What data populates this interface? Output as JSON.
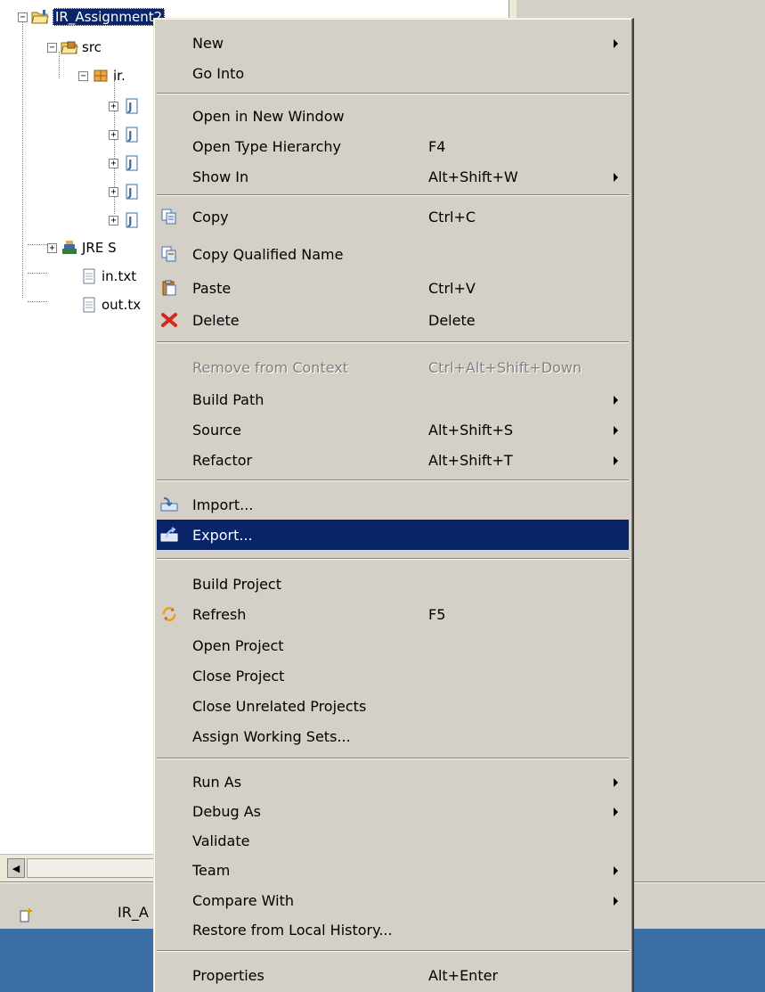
{
  "tree": {
    "project": "IR_Assignment2",
    "src": "src",
    "package": "ir.",
    "jre": "JRE S",
    "files": [
      "in.txt",
      "out.tx"
    ]
  },
  "status_bar": {
    "text": "IR_A"
  },
  "menu": {
    "items": [
      {
        "label": "New",
        "shortcut": "",
        "submenu": true
      },
      {
        "label": "Go Into",
        "shortcut": "",
        "submenu": false
      },
      {
        "label": "Open in New Window",
        "shortcut": "",
        "submenu": false
      },
      {
        "label": "Open Type Hierarchy",
        "shortcut": "F4",
        "submenu": false
      },
      {
        "label": "Show In",
        "shortcut": "Alt+Shift+W",
        "submenu": true
      },
      {
        "label": "Copy",
        "shortcut": "Ctrl+C",
        "submenu": false,
        "icon": "copy-icon"
      },
      {
        "label": "Copy Qualified Name",
        "shortcut": "",
        "submenu": false,
        "icon": "copy-qualified-name-icon"
      },
      {
        "label": "Paste",
        "shortcut": "Ctrl+V",
        "submenu": false,
        "icon": "paste-icon"
      },
      {
        "label": "Delete",
        "shortcut": "Delete",
        "submenu": false,
        "icon": "delete-icon"
      },
      {
        "label": "Remove from Context",
        "shortcut": "Ctrl+Alt+Shift+Down",
        "submenu": false,
        "disabled": true
      },
      {
        "label": "Build Path",
        "shortcut": "",
        "submenu": true
      },
      {
        "label": "Source",
        "shortcut": "Alt+Shift+S",
        "submenu": true
      },
      {
        "label": "Refactor",
        "shortcut": "Alt+Shift+T",
        "submenu": true
      },
      {
        "label": "Import...",
        "shortcut": "",
        "submenu": false,
        "icon": "import-icon"
      },
      {
        "label": "Export...",
        "shortcut": "",
        "submenu": false,
        "icon": "export-icon",
        "highlighted": true
      },
      {
        "label": "Build Project",
        "shortcut": "",
        "submenu": false
      },
      {
        "label": "Refresh",
        "shortcut": "F5",
        "submenu": false,
        "icon": "refresh-icon"
      },
      {
        "label": "Open Project",
        "shortcut": "",
        "submenu": false
      },
      {
        "label": "Close Project",
        "shortcut": "",
        "submenu": false
      },
      {
        "label": "Close Unrelated Projects",
        "shortcut": "",
        "submenu": false
      },
      {
        "label": "Assign Working Sets...",
        "shortcut": "",
        "submenu": false
      },
      {
        "label": "Run As",
        "shortcut": "",
        "submenu": true
      },
      {
        "label": "Debug As",
        "shortcut": "",
        "submenu": true
      },
      {
        "label": "Validate",
        "shortcut": "",
        "submenu": false
      },
      {
        "label": "Team",
        "shortcut": "",
        "submenu": true
      },
      {
        "label": "Compare With",
        "shortcut": "",
        "submenu": true
      },
      {
        "label": "Restore from Local History...",
        "shortcut": "",
        "submenu": false
      },
      {
        "label": "Properties",
        "shortcut": "Alt+Enter",
        "submenu": false
      }
    ]
  },
  "colors": {
    "menu_bg": "#d4d0c8",
    "highlight": "#0a246a",
    "taskbar": "#3a6ea5"
  }
}
